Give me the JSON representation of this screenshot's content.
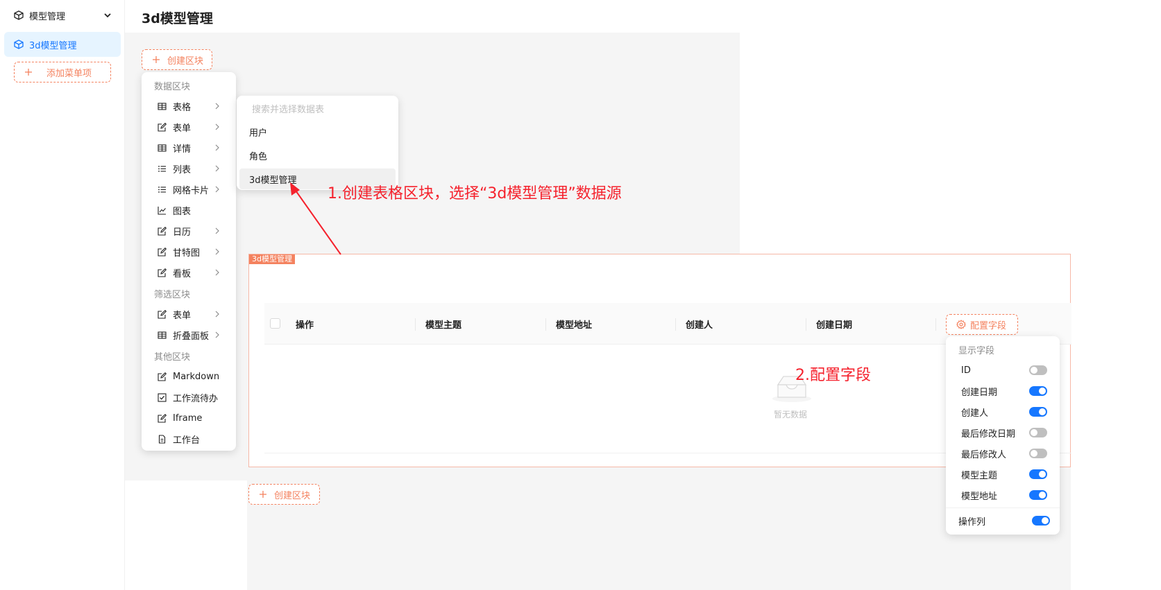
{
  "sidebar": {
    "group_label": "模型管理",
    "item_label": "3d模型管理",
    "add_menu_label": "添加菜单项"
  },
  "page": {
    "title": "3d模型管理",
    "create_block_label": "创建区块"
  },
  "menu": {
    "groups": [
      "数据区块",
      "筛选区块",
      "其他区块"
    ],
    "data_items": [
      {
        "label": "表格",
        "icon": "table-icon"
      },
      {
        "label": "表单",
        "icon": "edit-icon"
      },
      {
        "label": "详情",
        "icon": "table-icon"
      },
      {
        "label": "列表",
        "icon": "list-icon"
      },
      {
        "label": "网格卡片",
        "icon": "list-icon"
      },
      {
        "label": "图表",
        "icon": "chart-icon"
      },
      {
        "label": "日历",
        "icon": "edit-icon"
      },
      {
        "label": "甘特图",
        "icon": "edit-icon"
      },
      {
        "label": "看板",
        "icon": "edit-icon"
      }
    ],
    "filter_items": [
      {
        "label": "表单",
        "icon": "edit-icon"
      },
      {
        "label": "折叠面板",
        "icon": "table-icon"
      }
    ],
    "other_items": [
      {
        "label": "Markdown",
        "icon": "edit-icon"
      },
      {
        "label": "工作流待办",
        "icon": "checkbox-icon"
      },
      {
        "label": "Iframe",
        "icon": "edit-icon"
      },
      {
        "label": "工作台",
        "icon": "file-icon"
      }
    ]
  },
  "submenu": {
    "search_placeholder": "搜索并选择数据表",
    "items": [
      "用户",
      "角色",
      "3d模型管理"
    ]
  },
  "block": {
    "tag": "3d模型管理",
    "columns": [
      "操作",
      "模型主题",
      "模型地址",
      "创建人",
      "创建日期"
    ],
    "config_label": "配置字段",
    "empty_text": "暂无数据"
  },
  "fields": {
    "title": "显示字段",
    "items": [
      {
        "label": "ID",
        "on": false
      },
      {
        "label": "创建日期",
        "on": true
      },
      {
        "label": "创建人",
        "on": true
      },
      {
        "label": "最后修改日期",
        "on": false
      },
      {
        "label": "最后修改人",
        "on": false
      },
      {
        "label": "模型主题",
        "on": true
      },
      {
        "label": "模型地址",
        "on": true
      }
    ],
    "action_column": {
      "label": "操作列",
      "on": true
    }
  },
  "annotations": {
    "step1": "1.创建表格区块，选择“3d模型管理”数据源",
    "step2": "2.配置字段"
  },
  "colors": {
    "accent": "#f4825f",
    "primary": "#1677ff",
    "annotation": "#f5222d"
  }
}
